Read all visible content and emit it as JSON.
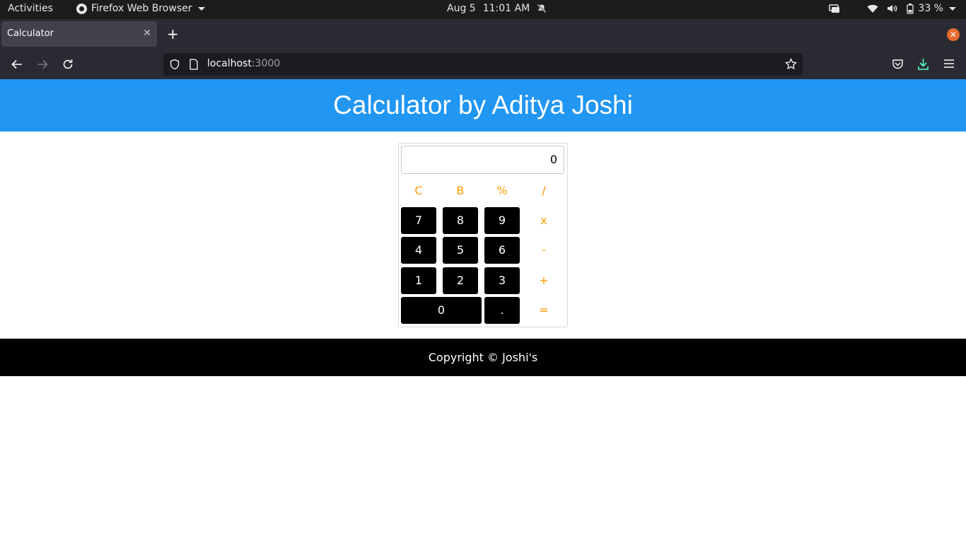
{
  "system_bar": {
    "activities": "Activities",
    "app_name": "Firefox Web Browser",
    "date": "Aug 5",
    "time": "11:01 AM",
    "battery": "33 %",
    "icons": [
      "firefox-icon",
      "notifications-off-icon",
      "screen-share-icon",
      "wifi-icon",
      "volume-icon",
      "battery-icon",
      "power-menu-icon"
    ]
  },
  "browser": {
    "tab_title": "Calculator",
    "url_host": "localhost",
    "url_port": ":3000",
    "accent_close": "#e66a2c"
  },
  "page": {
    "header_title": "Calculator by Aditya Joshi",
    "header_color": "#2196f3",
    "operator_color": "#ff9800",
    "calculator": {
      "display_value": "0",
      "keys": [
        {
          "label": "C",
          "kind": "op",
          "name": "clear-button"
        },
        {
          "label": "B",
          "kind": "op",
          "name": "backspace-button"
        },
        {
          "label": "%",
          "kind": "op",
          "name": "percent-button"
        },
        {
          "label": "/",
          "kind": "op",
          "name": "divide-button"
        },
        {
          "label": "7",
          "kind": "num",
          "name": "digit-7-button"
        },
        {
          "label": "8",
          "kind": "num",
          "name": "digit-8-button"
        },
        {
          "label": "9",
          "kind": "num",
          "name": "digit-9-button"
        },
        {
          "label": "x",
          "kind": "op",
          "name": "multiply-button"
        },
        {
          "label": "4",
          "kind": "num",
          "name": "digit-4-button"
        },
        {
          "label": "5",
          "kind": "num",
          "name": "digit-5-button"
        },
        {
          "label": "6",
          "kind": "num",
          "name": "digit-6-button"
        },
        {
          "label": "-",
          "kind": "op",
          "name": "subtract-button"
        },
        {
          "label": "1",
          "kind": "num",
          "name": "digit-1-button"
        },
        {
          "label": "2",
          "kind": "num",
          "name": "digit-2-button"
        },
        {
          "label": "3",
          "kind": "num",
          "name": "digit-3-button"
        },
        {
          "label": "+",
          "kind": "op",
          "name": "add-button"
        },
        {
          "label": "0",
          "kind": "num",
          "name": "digit-0-button"
        },
        {
          "label": ".",
          "kind": "num",
          "name": "decimal-button"
        },
        {
          "label": "=",
          "kind": "op",
          "name": "equals-button"
        }
      ]
    },
    "footer_text": "Copyright © Joshi's"
  }
}
